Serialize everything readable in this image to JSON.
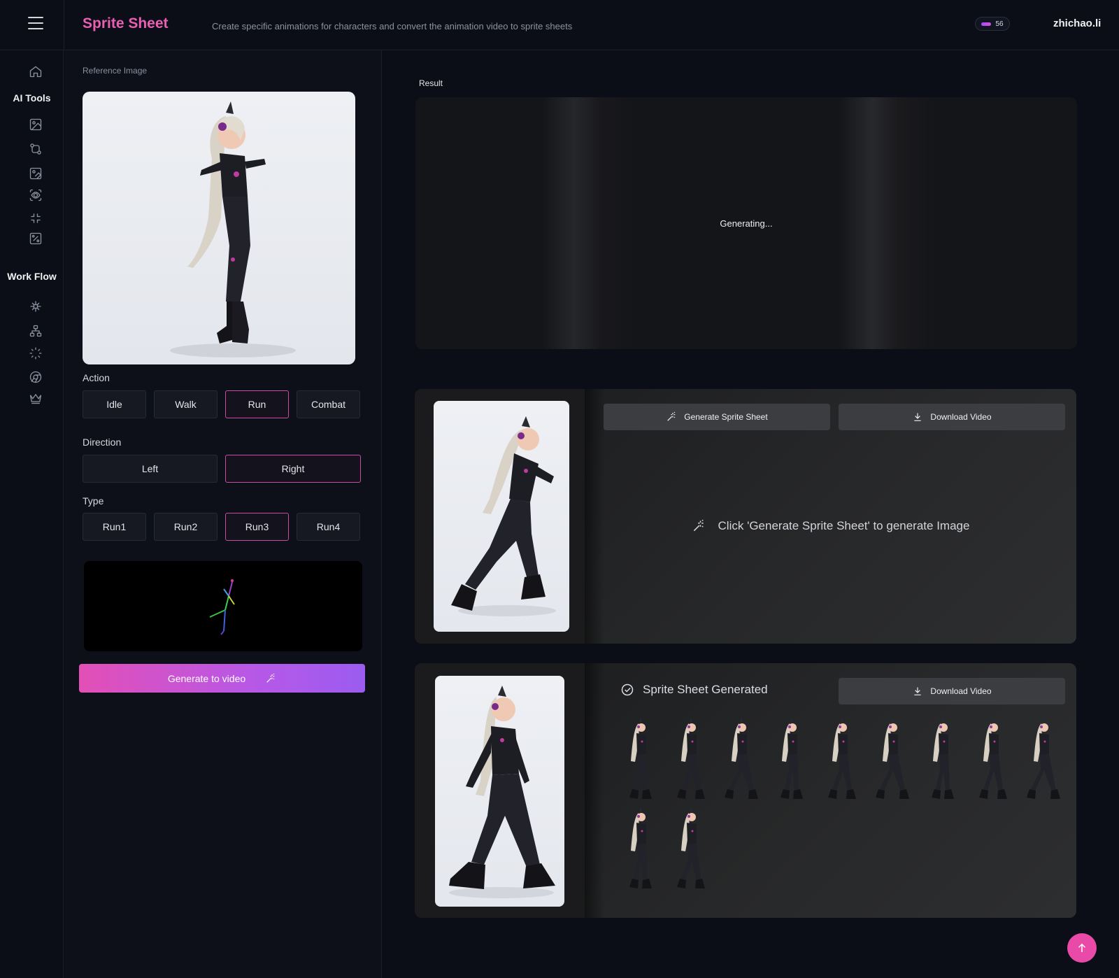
{
  "header": {
    "title": "Sprite Sheet",
    "subtitle": "Create specific animations for characters and convert the animation video to sprite sheets",
    "credits": "56",
    "username": "zhichao.li"
  },
  "nav": {
    "ai_tools_heading": "AI Tools",
    "workflow_heading": "Work Flow"
  },
  "settings": {
    "reference_label": "Reference Image",
    "action_label": "Action",
    "actions": [
      "Idle",
      "Walk",
      "Run",
      "Combat"
    ],
    "selected_action": "Run",
    "direction_label": "Direction",
    "directions": [
      "Left",
      "Right"
    ],
    "selected_direction": "Right",
    "type_label": "Type",
    "types": [
      "Run1",
      "Run2",
      "Run3",
      "Run4"
    ],
    "selected_type": "Run3",
    "generate_video_label": "Generate to video"
  },
  "result": {
    "label": "Result",
    "status": "Generating..."
  },
  "card_pending": {
    "generate_label": "Generate Sprite Sheet",
    "download_label": "Download Video",
    "placeholder": "Click 'Generate Sprite Sheet' to generate Image"
  },
  "card_done": {
    "title": "Sprite Sheet Generated",
    "download_label": "Download Video",
    "frame_count": 11
  },
  "colors": {
    "accent": "#e85fb4",
    "active_border": "#c94aa7",
    "background": "#0b0e16"
  }
}
